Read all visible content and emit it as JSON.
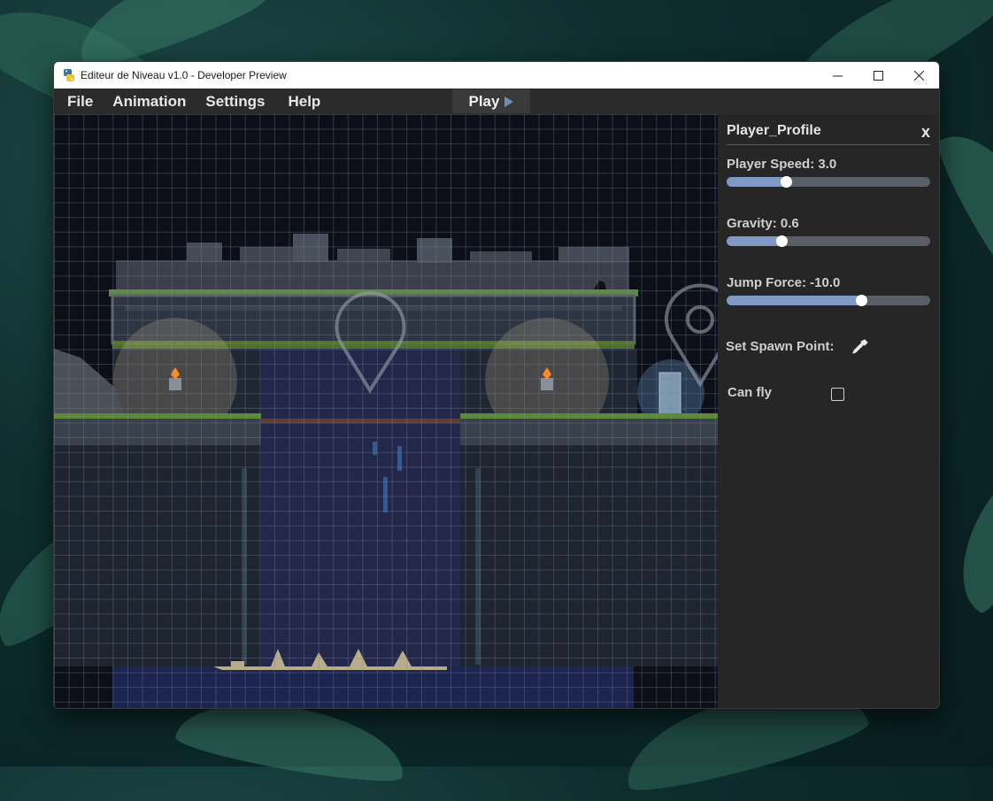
{
  "window": {
    "title": "Editeur de Niveau v1.0 - Developer Preview"
  },
  "menu": {
    "file": "File",
    "animation": "Animation",
    "settings": "Settings",
    "help": "Help",
    "play": "Play"
  },
  "panel": {
    "title": "Player_Profile",
    "close": "x",
    "player_speed": {
      "label": "Player Speed: 3.0",
      "fraction": 0.29
    },
    "gravity": {
      "label": "Gravity: 0.6",
      "fraction": 0.27
    },
    "jump_force": {
      "label": "Jump Force: -10.0",
      "fraction": 0.66
    },
    "spawn": {
      "label": "Set Spawn Point:",
      "icon": "eyedropper-icon"
    },
    "can_fly": {
      "label": "Can fly",
      "checked": false
    }
  },
  "colors": {
    "accent": "#7f98c4",
    "panel_bg": "#262626",
    "canvas_bg": "#0c0f17"
  }
}
